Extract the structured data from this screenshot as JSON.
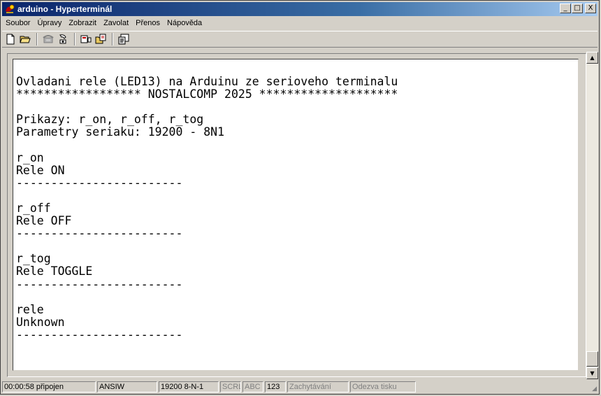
{
  "window": {
    "title": "arduino - Hyperterminál",
    "buttons": {
      "minimize": "_",
      "maximize": "□",
      "close": "X"
    }
  },
  "menu": [
    "Soubor",
    "Úpravy",
    "Zobrazit",
    "Zavolat",
    "Přenos",
    "Nápověda"
  ],
  "toolbar": {
    "groups": [
      [
        "new-connection-icon",
        "open-folder-icon"
      ],
      [
        "phone-call-icon",
        "disconnect-icon"
      ],
      [
        "send-file-icon",
        "receive-file-icon"
      ],
      [
        "properties-icon"
      ]
    ]
  },
  "terminal": {
    "lines": [
      "Ovladani rele (LED13) na Arduinu ze serioveho terminalu",
      "****************** NOSTALCOMP 2025 ********************",
      "",
      "Prikazy: r_on, r_off, r_tog",
      "Parametry seriaku: 19200 - 8N1",
      "",
      "r_on",
      "Rele ON",
      "------------------------",
      "",
      "r_off",
      "Rele OFF",
      "------------------------",
      "",
      "r_tog",
      "Rele TOGGLE",
      "------------------------",
      "",
      "rele",
      "Unknown",
      "------------------------"
    ]
  },
  "status": {
    "connected_time": "00:00:58 připojen",
    "emulation": "ANSIW",
    "port_settings": "19200 8-N-1",
    "scroll_lock": "SCRL",
    "caps_lock": "ABC",
    "num_lock": "123",
    "capture": "Zachytávání",
    "print_echo": "Odezva tisku"
  },
  "colors": {
    "title_start": "#0a246a",
    "title_end": "#a6caf0",
    "chrome": "#d4d0c8"
  }
}
